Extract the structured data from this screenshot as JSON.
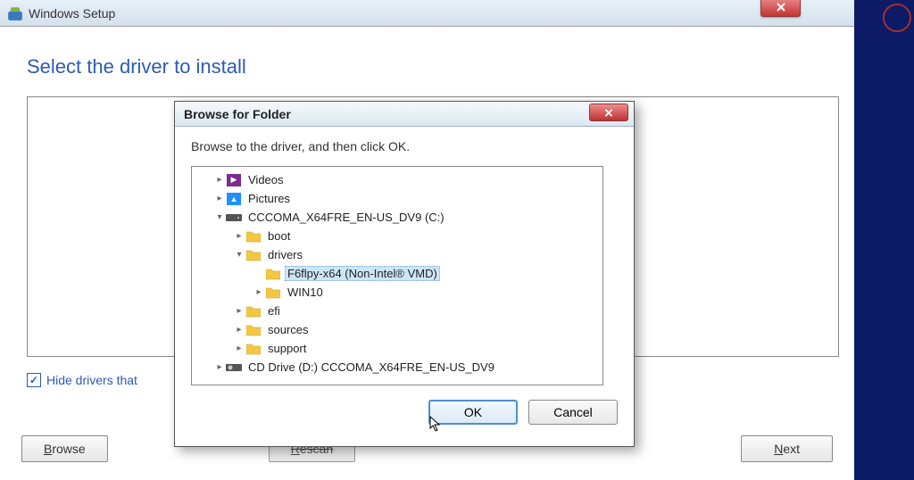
{
  "main_window": {
    "title": "Windows Setup",
    "heading": "Select the driver to install",
    "hide_drivers_checkbox_label": "Hide drivers that",
    "hide_drivers_checked": true,
    "buttons": {
      "browse": "Browse",
      "rescan": "Rescan",
      "next": "Next"
    }
  },
  "dialog": {
    "title": "Browse for Folder",
    "instruction": "Browse to the driver, and then click OK.",
    "tree": [
      {
        "level": 1,
        "expander": ">",
        "icon": "video",
        "label": "Videos"
      },
      {
        "level": 1,
        "expander": ">",
        "icon": "picture",
        "label": "Pictures"
      },
      {
        "level": 1,
        "expander": "v",
        "icon": "drive",
        "label": "CCCOMA_X64FRE_EN-US_DV9 (C:)"
      },
      {
        "level": 2,
        "expander": ">",
        "icon": "folder",
        "label": "boot"
      },
      {
        "level": 2,
        "expander": "v",
        "icon": "folder",
        "label": "drivers"
      },
      {
        "level": 3,
        "expander": "",
        "icon": "folder",
        "label": "F6flpy-x64 (Non-Intel® VMD)",
        "selected": true
      },
      {
        "level": 3,
        "expander": ">",
        "icon": "folder",
        "label": "WIN10"
      },
      {
        "level": 2,
        "expander": ">",
        "icon": "folder",
        "label": "efi"
      },
      {
        "level": 2,
        "expander": ">",
        "icon": "folder",
        "label": "sources"
      },
      {
        "level": 2,
        "expander": ">",
        "icon": "folder",
        "label": "support"
      },
      {
        "level": 1,
        "expander": ">",
        "icon": "cd",
        "label": "CD Drive (D:) CCCOMA_X64FRE_EN-US_DV9"
      }
    ],
    "buttons": {
      "ok": "OK",
      "cancel": "Cancel"
    }
  }
}
